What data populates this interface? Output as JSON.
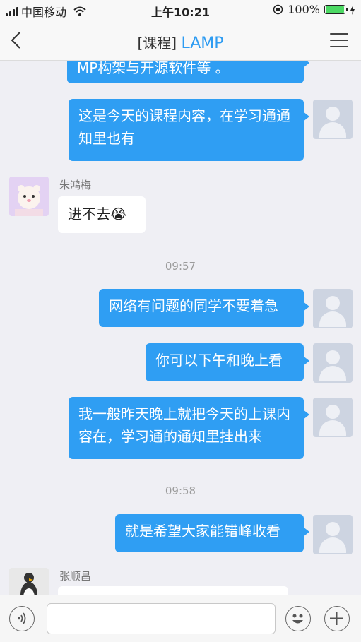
{
  "status": {
    "carrier": "中国移动",
    "time": "上午10:21",
    "battery": "100%"
  },
  "nav": {
    "title_prefix": "[课程]",
    "title_name": "LAMP"
  },
  "messages": {
    "m0": {
      "text": "MP构架与开源软件等 。"
    },
    "m1": {
      "text": "这是今天的课程内容，在学习通通知里也有"
    },
    "m2": {
      "sender": "朱鸿梅",
      "text": "进不去😭"
    },
    "ts1": "09:57",
    "m3": {
      "text": "网络有问题的同学不要着急"
    },
    "m4": {
      "text": "你可以下午和晚上看"
    },
    "m5": {
      "text": "我一般昨天晚上就把今天的上课内容在，学习通的通知里挂出来"
    },
    "ts2": "09:58",
    "m6": {
      "text": "就是希望大家能错峰收看"
    },
    "m7": {
      "sender": "张顺昌"
    }
  },
  "input": {
    "value": ""
  }
}
